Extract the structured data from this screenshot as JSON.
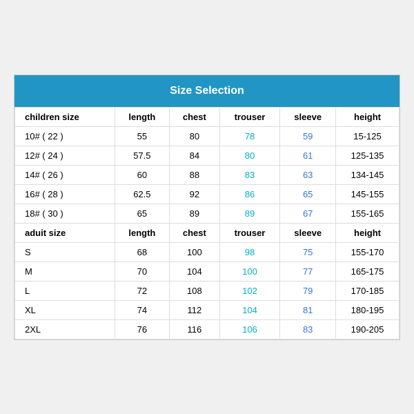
{
  "title": "Size Selection",
  "columns": [
    "children size",
    "length",
    "chest",
    "trouser",
    "sleeve",
    "height"
  ],
  "adult_columns": [
    "aduit size",
    "length",
    "chest",
    "trouser",
    "sleeve",
    "height"
  ],
  "children_rows": [
    [
      "10# ( 22 )",
      "55",
      "80",
      "78",
      "59",
      "15-125"
    ],
    [
      "12# ( 24 )",
      "57.5",
      "84",
      "80",
      "61",
      "125-135"
    ],
    [
      "14# ( 26 )",
      "60",
      "88",
      "83",
      "63",
      "134-145"
    ],
    [
      "16# ( 28 )",
      "62.5",
      "92",
      "86",
      "65",
      "145-155"
    ],
    [
      "18# ( 30 )",
      "65",
      "89",
      "89",
      "67",
      "155-165"
    ]
  ],
  "adult_rows": [
    [
      "S",
      "68",
      "100",
      "98",
      "75",
      "155-170"
    ],
    [
      "M",
      "70",
      "104",
      "100",
      "77",
      "165-175"
    ],
    [
      "L",
      "72",
      "108",
      "102",
      "79",
      "170-185"
    ],
    [
      "XL",
      "74",
      "112",
      "104",
      "81",
      "180-195"
    ],
    [
      "2XL",
      "76",
      "116",
      "106",
      "83",
      "190-205"
    ]
  ]
}
